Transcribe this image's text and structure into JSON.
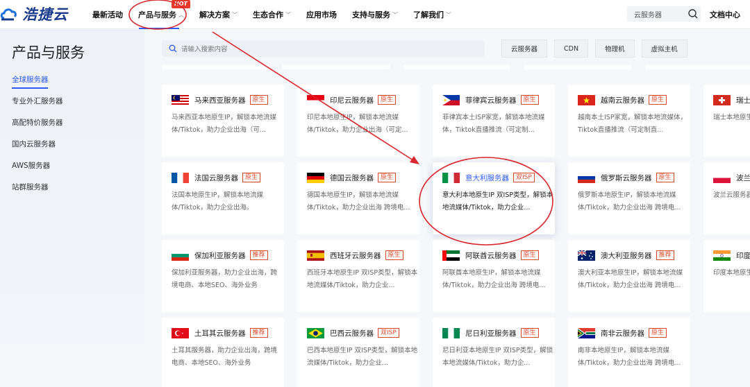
{
  "brand": {
    "name": "浩捷云"
  },
  "nav": {
    "items": [
      {
        "label": "最新活动",
        "dropdown": false
      },
      {
        "label": "产品与服务",
        "dropdown": true,
        "badge": "HOT",
        "active": true
      },
      {
        "label": "解决方案",
        "dropdown": true
      },
      {
        "label": "生态合作",
        "dropdown": true
      },
      {
        "label": "应用市场",
        "dropdown": false
      },
      {
        "label": "支持与服务",
        "dropdown": true
      },
      {
        "label": "了解我们",
        "dropdown": true
      }
    ],
    "search_placeholder": "云服务器",
    "doc_link": "文档中心"
  },
  "sidebar": {
    "title": "产品与服务",
    "items": [
      {
        "label": "全球服务器",
        "active": true
      },
      {
        "label": "专业外汇服务器"
      },
      {
        "label": "高配特价服务器"
      },
      {
        "label": "国内云服务器"
      },
      {
        "label": "AWS服务器"
      },
      {
        "label": "站群服务器"
      }
    ]
  },
  "main": {
    "search_placeholder": "请输入搜索内容",
    "chips": [
      "云服务器",
      "CDN",
      "物理机",
      "虚拟主机"
    ],
    "cards": [
      {
        "flag": "my",
        "title": "马来西亚服务器",
        "tag": "原生",
        "desc": "马来西亚本地原生IP，解锁本地流媒体/Tiktok，助力企业出海（可..."
      },
      {
        "flag": "id",
        "title": "印尼云服务器",
        "tag": "原生",
        "desc": "印尼本地原生IP，解锁本地流媒体/Tiktok，助力企业出海（可定..."
      },
      {
        "flag": "ph",
        "title": "菲律宾云服务器",
        "tag": "原生",
        "desc": "菲律宾本土ISP家宽，解锁本地流媒体，Tiktok直播推流（可定制..."
      },
      {
        "flag": "vn",
        "title": "越南云服务器",
        "tag": "原生",
        "desc": "越南本土ISP家宽，解锁本地流媒体，Tiktok直播推流（可定制直..."
      },
      {
        "flag": "ch",
        "title": "瑞士云",
        "tag": "",
        "desc": "瑞士本地原生IP，体/Tiktok，助"
      },
      {
        "flag": "fr",
        "title": "法国云服务器",
        "tag": "原生",
        "desc": "法国本地原生IP，解锁本地流媒体/Tiktok，助力企业出海。"
      },
      {
        "flag": "de",
        "title": "德国云服务器",
        "tag": "原生",
        "desc": "德国本地原生IP，解锁本地流媒体/Tiktok，助力企业出海 跨境电..."
      },
      {
        "flag": "it",
        "title": "意大利服务器",
        "tag": "双ISP",
        "desc": "意大利本地原生IP 双ISP类型，解锁本地流媒体/Tiktok，助力企业...",
        "highlight": true
      },
      {
        "flag": "ru",
        "title": "俄罗斯云服务器",
        "tag": "原生",
        "desc": "俄罗斯本地原生IP，解锁本地流媒体/Tiktok，助力企业出海 跨境电..."
      },
      {
        "flag": "pl",
        "title": "波兰云",
        "tag": "",
        "desc": "波兰云服务器，助跨境电商、本地SE"
      },
      {
        "flag": "bg",
        "title": "保加利亚服务器",
        "tag": "推荐",
        "desc": "保加利亚服务器，助力企业出海，跨境电商、本地SEO、海外业务"
      },
      {
        "flag": "es",
        "title": "西班牙云服务器",
        "tag": "原生",
        "desc": "西班牙本地原生IP 双ISP类型，解锁本地流媒体/Tiktok，助力企业..."
      },
      {
        "flag": "ae",
        "title": "阿联酋云服务器",
        "tag": "原生",
        "desc": "阿联酋本地原生IP，解锁本地流媒体/Tiktok，助力企业出海 跨境电..."
      },
      {
        "flag": "au",
        "title": "澳大利亚服务器",
        "tag": "推荐",
        "desc": "澳大利亚本地原生IP，解锁本地流媒体/Tiktok，助力企业出海 跨境电..."
      },
      {
        "flag": "in",
        "title": "印度云",
        "tag": "",
        "desc": "印度本地原生IP，体/Tiktok，助"
      },
      {
        "flag": "tr",
        "title": "土耳其云服务器",
        "tag": "推荐",
        "desc": "土耳其服务器，助力企业出海，跨境电商、本地SEO、海外业务"
      },
      {
        "flag": "br",
        "title": "巴西云服务器",
        "tag": "双ISP",
        "desc": "巴西本地原生IP 双ISP类型，解锁本地流媒体/Tiktok，助力企业..."
      },
      {
        "flag": "ng",
        "title": "尼日利亚服务器",
        "tag": "原生",
        "desc": "尼日利亚本地原生IP 双ISP类型，解锁本地流媒体/Tiktok，助力企..."
      },
      {
        "flag": "za",
        "title": "南非云服务器",
        "tag": "原生",
        "desc": "南非本地原生IP，解锁本地流媒体/Tiktok，助力企业出海 跨境电..."
      }
    ]
  },
  "colors": {
    "accent": "#2e5bff",
    "tag": "#e0482b",
    "annotation": "#d9262b"
  }
}
